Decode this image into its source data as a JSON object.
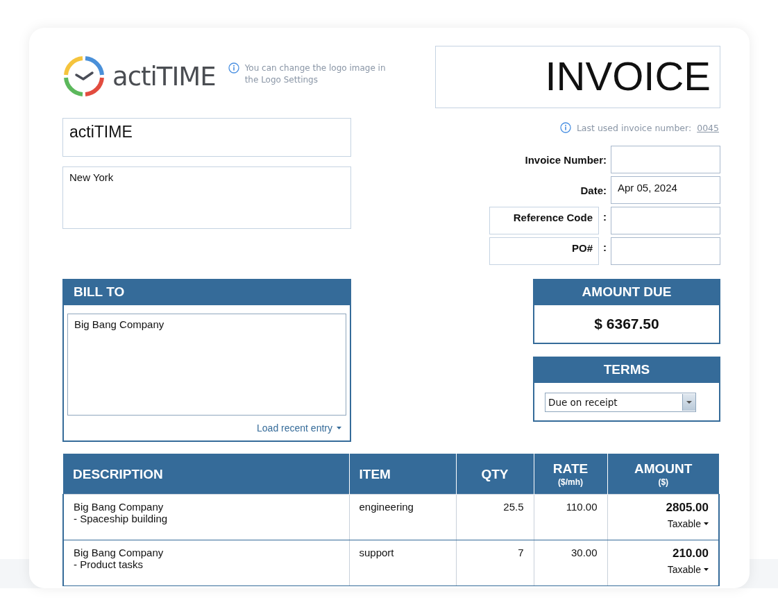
{
  "logo": {
    "wordmark": "actiTIME",
    "hint": "You can change the logo image in the Logo Settings"
  },
  "title": "INVOICE",
  "company": {
    "name": "actiTIME",
    "address": "New York"
  },
  "last_used": {
    "label": "Last used invoice number:",
    "number": "0045"
  },
  "fields": [
    {
      "kind": "plain",
      "label": "Invoice Number:"
    },
    {
      "kind": "plain",
      "label": "Date:",
      "value": "Apr 05, 2024"
    },
    {
      "kind": "custom",
      "label": "Reference Code",
      "colon": ":"
    },
    {
      "kind": "custom",
      "label": "PO#",
      "colon": ":"
    }
  ],
  "bill_to": {
    "title": "BILL TO",
    "value": "Big Bang Company",
    "load_link": "Load recent entry"
  },
  "amount_due": {
    "title": "AMOUNT DUE",
    "value": "$ 6367.50"
  },
  "terms": {
    "title": "TERMS",
    "value": "Due on receipt"
  },
  "table": {
    "columns": [
      {
        "label": "DESCRIPTION"
      },
      {
        "label": "ITEM"
      },
      {
        "label": "QTY"
      },
      {
        "label": "RATE",
        "sub": "($/mh)"
      },
      {
        "label": "AMOUNT",
        "sub": "($)"
      }
    ],
    "rows": [
      {
        "company": "Big Bang Company",
        "task": "- Spaceship building",
        "item": "engineering",
        "qty": "25.5",
        "rate": "110.00",
        "amount": "2805.00",
        "tax": "Taxable"
      },
      {
        "company": "Big Bang Company",
        "task": "- Product tasks",
        "item": "support",
        "qty": "7",
        "rate": "30.00",
        "amount": "210.00",
        "tax": "Taxable"
      }
    ]
  }
}
